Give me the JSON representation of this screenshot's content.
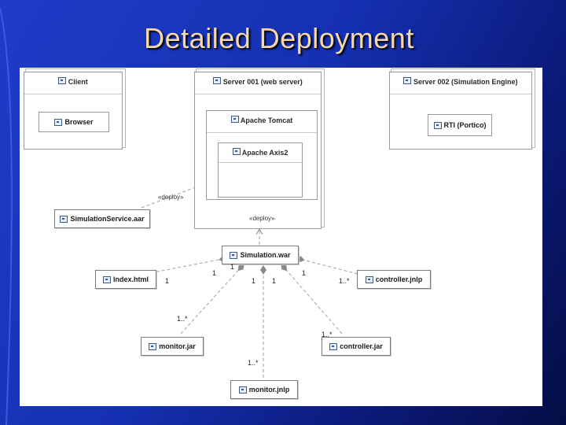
{
  "slide": {
    "title": "Detailed Deployment"
  },
  "nodes": {
    "client": {
      "title": "Client",
      "artifacts": {
        "browser": "Browser"
      }
    },
    "server1": {
      "title": "Server 001 (web server)",
      "tomcat": "Apache Tomcat",
      "axis": "Apache Axis2"
    },
    "server2": {
      "title": "Server 002 (Simulation Engine)",
      "rti": "RTI (Portico)"
    }
  },
  "artifacts": {
    "simulation_service": "SimulationService.aar",
    "simulation_war": "Simulation.war",
    "index_html": "Index.html",
    "controller_jnlp": "controller.jnlp",
    "monitor_jar": "monitor.jar",
    "controller_jar": "controller.jar",
    "monitor_jnlp": "monitor.jnlp"
  },
  "stereotypes": {
    "deploy_axis": "«deploy»",
    "deploy_tomcat": "«deploy»"
  },
  "multiplicities": {
    "index_far": "1",
    "index_near": "1",
    "war_a": "1",
    "war_b": "1",
    "war_c": "1",
    "controller_near": "1",
    "controller_far": "1..*",
    "monitor_jar_far": "1..*",
    "controller_jar_far": "1..*",
    "monitor_jnlp_far": "1..*"
  },
  "icons": [
    "component-icon",
    "artifact-icon",
    "node-icon"
  ],
  "colors": {
    "background": "#1530b0",
    "title": "#f7d9a8",
    "panel": "#ffffff",
    "lines": "#a0a0a0"
  }
}
